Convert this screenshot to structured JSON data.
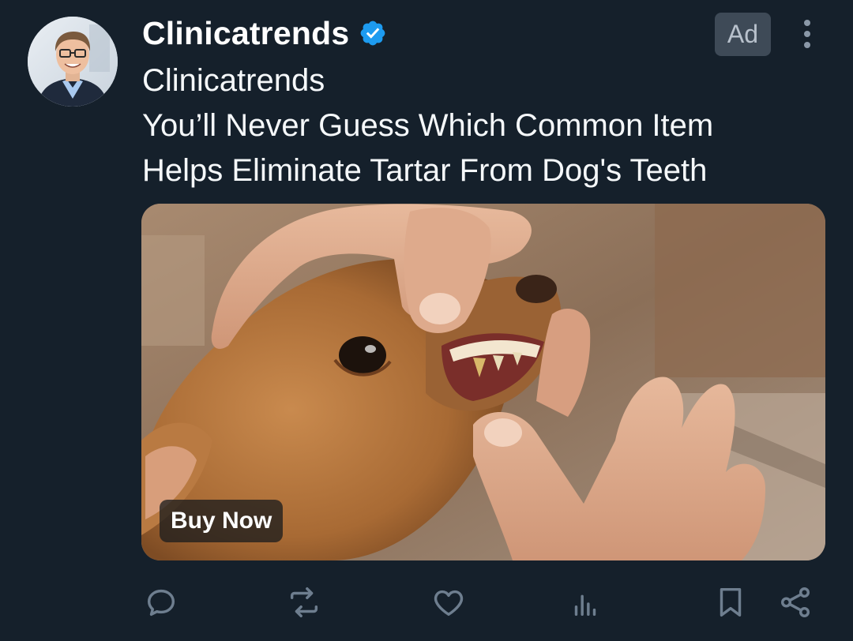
{
  "post": {
    "author": {
      "display_name": "Clinicatrends",
      "verified": true,
      "avatar_icon": "person-portrait-avatar"
    },
    "ad_badge": "Ad",
    "more_icon": "vertical-ellipsis-icon",
    "text_lines": [
      "Clinicatrends",
      "You’ll Never Guess Which Common Item",
      "Helps Eliminate Tartar From Dog's Teeth"
    ],
    "media": {
      "cta_label": "Buy Now"
    },
    "actions": [
      {
        "name": "reply",
        "icon": "speech-bubble-icon"
      },
      {
        "name": "repost",
        "icon": "repost-arrows-icon"
      },
      {
        "name": "like",
        "icon": "heart-icon"
      },
      {
        "name": "views",
        "icon": "bar-chart-icon"
      },
      {
        "name": "bookmark",
        "icon": "bookmark-icon"
      },
      {
        "name": "share",
        "icon": "share-nodes-icon"
      }
    ]
  },
  "colors": {
    "background": "#15202b",
    "text": "#ffffff",
    "muted_icon": "#6e7e8f",
    "verified_blue": "#1d9bf0",
    "ad_badge_bg": "#3e4a57"
  }
}
